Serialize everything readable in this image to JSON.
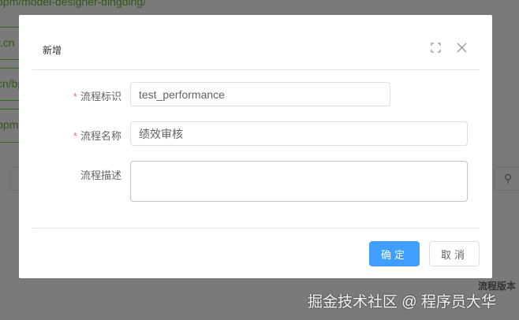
{
  "background": {
    "url_text": "bpm/model-designer-dingding/",
    "link_texts": [
      "r.cn",
      "cn/bp",
      "bpm"
    ],
    "column_header": "流程版本"
  },
  "dialog": {
    "title": "新增",
    "maximize_icon": "fullscreen-icon",
    "close_icon": "close-icon",
    "fields": [
      {
        "label": "流程标识",
        "required": true,
        "value": "test_performance"
      },
      {
        "label": "流程名称",
        "required": true,
        "value": "绩效审核"
      },
      {
        "label": "流程描述",
        "required": false,
        "value": ""
      }
    ],
    "confirm_label": "确定",
    "cancel_label": "取消",
    "required_mark": "*"
  },
  "watermark": "掘金技术社区 @ 程序员大华",
  "colors": {
    "primary": "#409eff",
    "required": "#f56c6c"
  }
}
